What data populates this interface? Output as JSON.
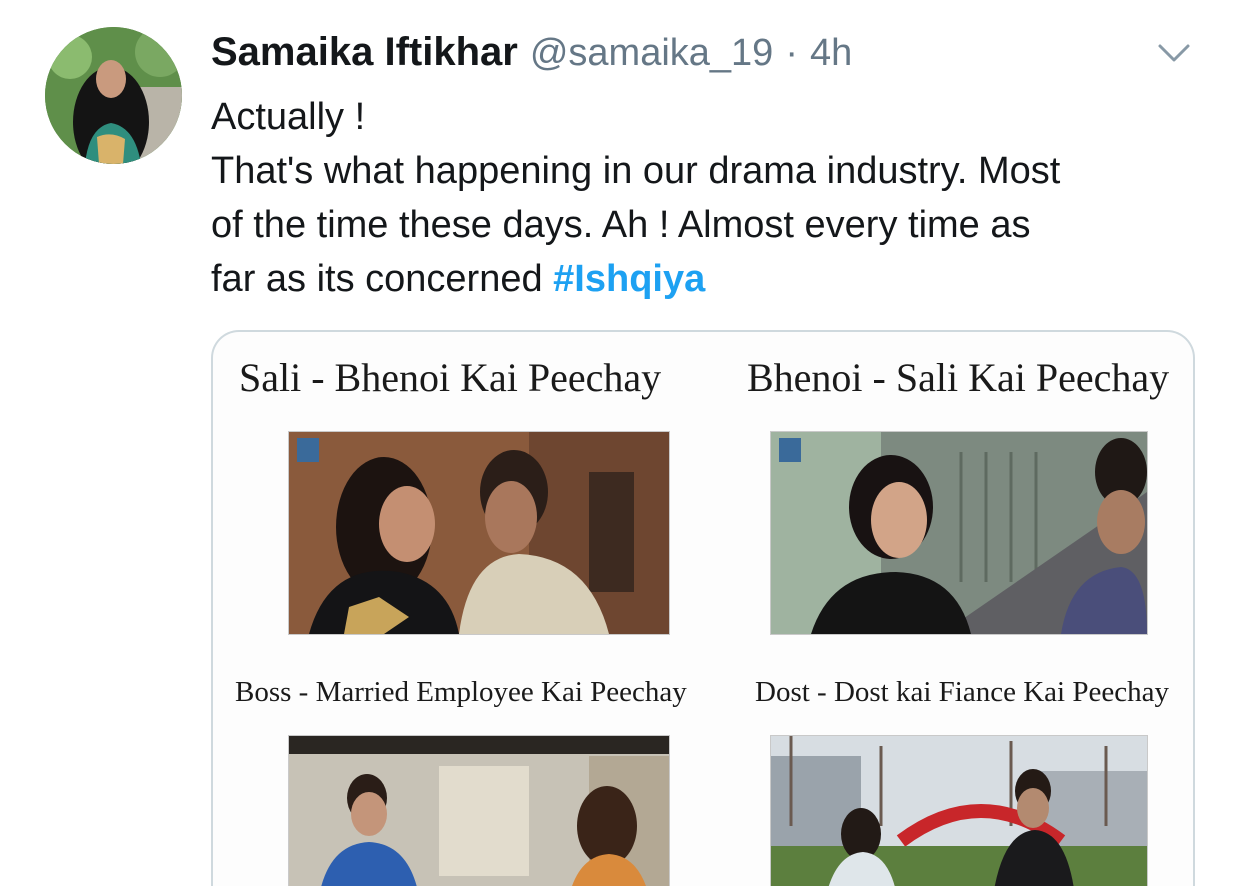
{
  "tweet": {
    "author_name": "Samaika Iftikhar",
    "handle": "@samaika_19",
    "separator": "·",
    "time": "4h",
    "menu_icon": "chevron-down-icon",
    "text_lines": [
      "Actually !",
      "That's what happening in our drama industry. Most",
      "of the time these days. Ah ! Almost every time as"
    ],
    "last_line_prefix": "far as its concerned ",
    "hashtag": "#Ishqiya"
  },
  "media": {
    "captions": [
      "Sali - Bhenoi Kai Peechay",
      "Bhenoi - Sali Kai Peechay",
      "Boss - Married Employee Kai Peechay",
      "Dost - Dost kai Fiance Kai Peechay"
    ]
  },
  "colors": {
    "text": "#14171a",
    "secondary": "#657786",
    "link": "#1da1f2",
    "border": "#cfd9de"
  }
}
